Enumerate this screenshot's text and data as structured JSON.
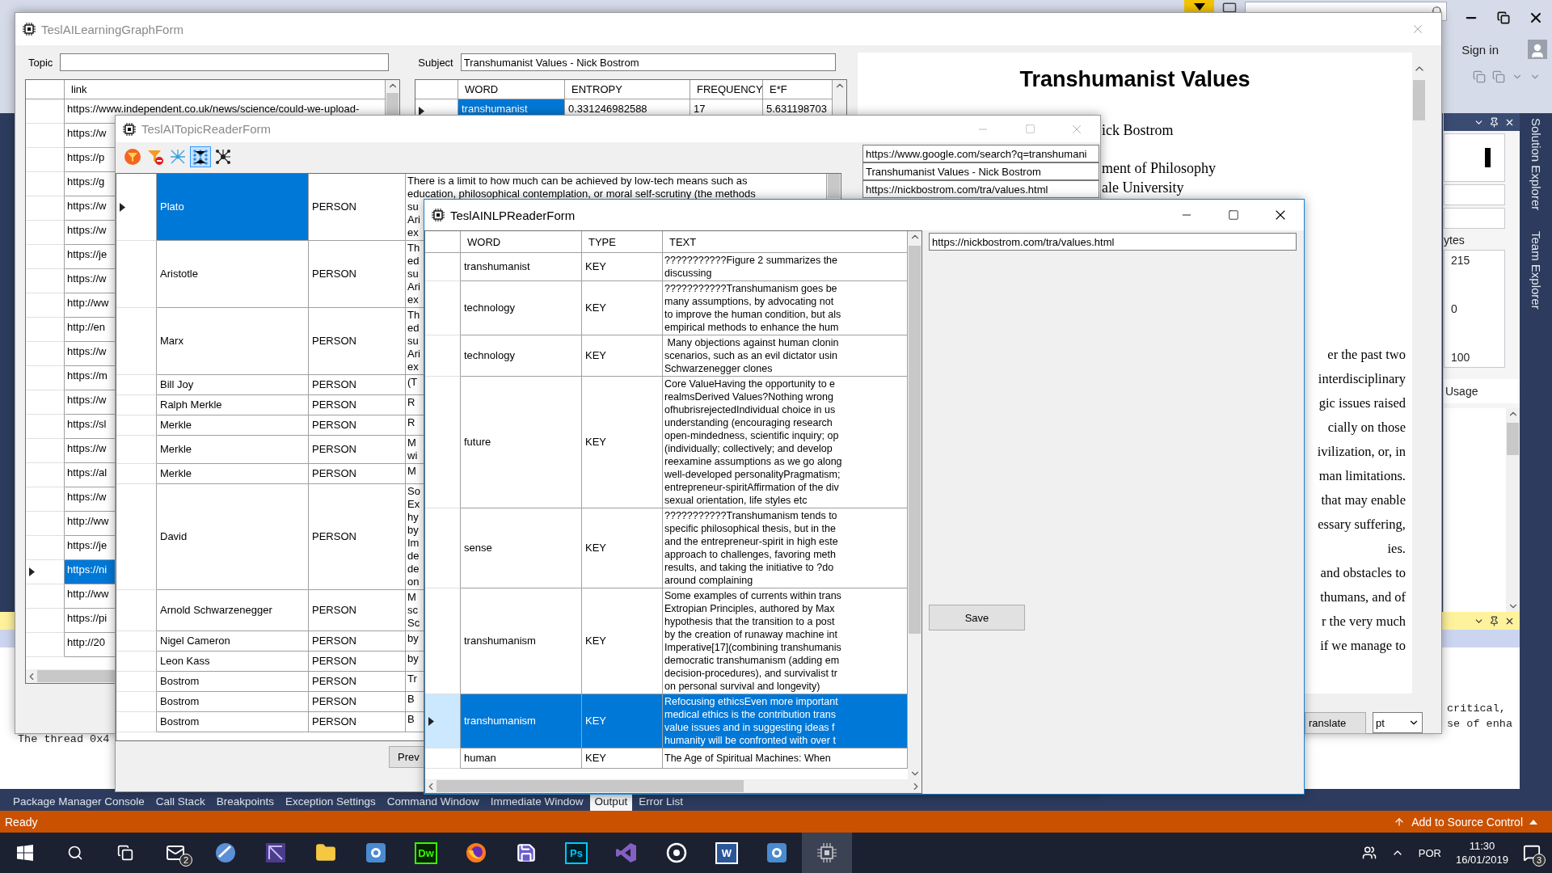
{
  "vs": {
    "sign_in": "Sign in",
    "side_tabs": [
      "Solution Explorer",
      "Team Explorer"
    ],
    "properties": {
      "label": "ytes",
      "values": [
        "215",
        "0",
        "100"
      ],
      "section": "Usage"
    },
    "output": {
      "right_lines": [
        "critical,",
        "se of enha"
      ],
      "left_line": "The thread 0x4"
    },
    "bottom_tabs": [
      {
        "label": "Package Manager Console",
        "selected": false
      },
      {
        "label": "Call Stack",
        "selected": false
      },
      {
        "label": "Breakpoints",
        "selected": false
      },
      {
        "label": "Exception Settings",
        "selected": false
      },
      {
        "label": "Command Window",
        "selected": false
      },
      {
        "label": "Immediate Window",
        "selected": false
      },
      {
        "label": "Output",
        "selected": true
      },
      {
        "label": "Error List",
        "selected": false
      }
    ],
    "status": {
      "text": "Ready",
      "source_control": "Add to Source Control"
    }
  },
  "learning_form": {
    "title": "TeslAILearningGraphForm",
    "active": false,
    "topic": {
      "label": "Topic"
    },
    "subject": {
      "label": "Subject",
      "value": "Transhumanist Values - Nick Bostrom"
    },
    "links": {
      "column": "link",
      "rows": [
        {
          "url": "https://www.independent.co.uk/news/science/could-we-upload-",
          "selected": false
        },
        {
          "url": "https://w",
          "selected": false
        },
        {
          "url": "https://p",
          "selected": false
        },
        {
          "url": "https://g",
          "selected": false
        },
        {
          "url": "https://w",
          "selected": false
        },
        {
          "url": "https://w",
          "selected": false
        },
        {
          "url": "https://je",
          "selected": false
        },
        {
          "url": "https://w",
          "selected": false
        },
        {
          "url": "http://ww",
          "selected": false
        },
        {
          "url": "http://en",
          "selected": false
        },
        {
          "url": "https://w",
          "selected": false
        },
        {
          "url": "https://m",
          "selected": false
        },
        {
          "url": "https://w",
          "selected": false
        },
        {
          "url": "https://sl",
          "selected": false
        },
        {
          "url": "https://w",
          "selected": false
        },
        {
          "url": "https://al",
          "selected": false
        },
        {
          "url": "https://w",
          "selected": false
        },
        {
          "url": "http://ww",
          "selected": false
        },
        {
          "url": "https://je",
          "selected": false
        },
        {
          "url": "https://ni",
          "selected": true
        },
        {
          "url": "http://ww",
          "selected": false
        },
        {
          "url": "https://pi",
          "selected": false
        },
        {
          "url": "http://20",
          "selected": false
        }
      ]
    },
    "words": {
      "columns": [
        "WORD",
        "ENTROPY",
        "FREQUENCY",
        "E*F"
      ],
      "rows": [
        {
          "cells": [
            "transhumanist",
            "0.331246982588",
            "17",
            "5.631198703"
          ],
          "selected": true
        }
      ]
    },
    "web": {
      "heading": "Transhumanist Values",
      "author": "ick Bostrom",
      "affiliation": [
        "ment of Philosophy",
        "ale University"
      ],
      "paragraph": [
        "er the past two",
        "interdisciplinary",
        "gic issues raised",
        "cially on those",
        "ivilization, or, in",
        "man limitations.",
        "that may enable",
        "essary suffering,",
        "ies.",
        "and obstacles to",
        "thumans, and of",
        "r the very much",
        "if we manage to"
      ]
    },
    "translate": "ranslate",
    "language": "pt"
  },
  "topic_form": {
    "title": "TeslAITopicReaderForm",
    "active": false,
    "toolbar": [
      {
        "kind": "filter",
        "selected": false
      },
      {
        "kind": "filter-remove",
        "selected": false
      },
      {
        "kind": "network",
        "selected": false
      },
      {
        "kind": "layers",
        "selected": true
      },
      {
        "kind": "nodes",
        "selected": false
      }
    ],
    "rows": [
      {
        "name": "Plato",
        "type": "PERSON",
        "text": "There is a limit to how much can be achieved by low-tech means such as\neducation, philosophical contemplation, or moral self-scrutiny (the methods\nsu\nAri\nex",
        "selected": true
      },
      {
        "name": "Aristotle",
        "type": "PERSON",
        "text": "Th\ned\nsu\nAri\nex",
        "selected": false
      },
      {
        "name": "Marx",
        "type": "PERSON",
        "text": "Th\ned\nsu\nAri\nex",
        "selected": false
      },
      {
        "name": "Bill Joy",
        "type": "PERSON",
        "text": "(T",
        "selected": false
      },
      {
        "name": "Ralph Merkle",
        "type": "PERSON",
        "text": "R",
        "selected": false
      },
      {
        "name": "Merkle",
        "type": "PERSON",
        "text": "R",
        "selected": false
      },
      {
        "name": "Merkle",
        "type": "PERSON",
        "text": "M\nwi",
        "selected": false
      },
      {
        "name": "Merkle",
        "type": "PERSON",
        "text": "M",
        "selected": false
      },
      {
        "name": "David",
        "type": "PERSON",
        "text": "So\nEx\nhy\nby\nIm\nde\nde\non",
        "selected": false
      },
      {
        "name": "Arnold Schwarzenegger",
        "type": "PERSON",
        "text": "M\nsc\nSc",
        "selected": false
      },
      {
        "name": "Nigel Cameron",
        "type": "PERSON",
        "text": "by",
        "selected": false
      },
      {
        "name": "Leon Kass",
        "type": "PERSON",
        "text": "by",
        "selected": false
      },
      {
        "name": "Bostrom",
        "type": "PERSON",
        "text": "Tr",
        "selected": false
      },
      {
        "name": "Bostrom",
        "type": "PERSON",
        "text": "B",
        "selected": false
      },
      {
        "name": "Bostrom",
        "type": "PERSON",
        "text": "B",
        "selected": false
      }
    ],
    "fields": [
      "https://www.google.com/search?q=transhumani",
      "Transhumanist Values - Nick Bostrom",
      "https://nickbostrom.com/tra/values.html"
    ],
    "prev_button": "Prev"
  },
  "nlp_form": {
    "title": "TeslAINLPReaderForm",
    "active": true,
    "columns": [
      "WORD",
      "TYPE",
      "TEXT"
    ],
    "rows": [
      {
        "word": "transhumanist",
        "type": "KEY",
        "text": "???????????Figure 2 summarizes the\ndiscussing",
        "selected": false
      },
      {
        "word": "technology",
        "type": "KEY",
        "text": "???????????Transhumanism goes be\nmany assumptions, by advocating not\nto improve the human condition, but als\nempirical methods to enhance the hum",
        "selected": false
      },
      {
        "word": "technology",
        "type": "KEY",
        "text": " Many objections against human clonin\nscenarios, such as an evil dictator usin\nSchwarzenegger clones",
        "selected": false
      },
      {
        "word": "future",
        "type": "KEY",
        "text": "Core ValueHaving the opportunity to e\nrealmsDerived Values?Nothing wrong\nofhubrisrejectedIndividual choice in us\nunderstanding (encouraging research\nopen-mindedness, scientific inquiry; op\n(individually; collectively; and develop\nreexamine assumptions as we go along\nwell-developed personalityPragmatism;\nentrepreneur-spiritAffirmation of the div\nsexual orientation, life styles etc",
        "selected": false
      },
      {
        "word": "sense",
        "type": "KEY",
        "text": "???????????Transhumanism tends to\nspecific philosophical thesis, but in the\nand the entrepreneur-spirit in high este\napproach to challenges, favoring meth\nresults, and taking the initiative to ?do\naround complaining",
        "selected": false
      },
      {
        "word": "transhumanism",
        "type": "KEY",
        "text": "Some examples of currents within trans\nExtropian Principles, authored by Max\nhypothesis that the transition to a post\nby the creation of runaway machine int\nImperative[17](combining transhumanis\ndemocratic transhumanism (adding em\ndecision-procedures), and survivalist tr\non personal survival and longevity)",
        "selected": false
      },
      {
        "word": "transhumanism",
        "type": "KEY",
        "text": "Refocusing ethicsEven more important\nmedical ethics is the contribution trans\nvalue issues and in suggesting ideas f\nhumanity will be confronted with over t",
        "selected": true
      },
      {
        "word": "human",
        "type": "KEY",
        "text": "The Age of Spiritual Machines: When",
        "selected": false
      }
    ],
    "url": "https://nickbostrom.com/tra/values.html",
    "save": "Save"
  },
  "taskbar": {
    "apps": [
      {
        "kind": "windows",
        "selected": false
      },
      {
        "kind": "search",
        "selected": false
      },
      {
        "kind": "taskview",
        "selected": false
      },
      {
        "kind": "mail",
        "badge": "2",
        "selected": false
      },
      {
        "kind": "globe",
        "selected": false
      },
      {
        "kind": "video",
        "selected": false
      },
      {
        "kind": "folder",
        "selected": false
      },
      {
        "kind": "camera",
        "selected": false
      },
      {
        "kind": "dw",
        "label": "Dw",
        "selected": false
      },
      {
        "kind": "firefox",
        "selected": false
      },
      {
        "kind": "floppy",
        "selected": false
      },
      {
        "kind": "ps",
        "label": "Ps",
        "selected": false
      },
      {
        "kind": "vs",
        "selected": false
      },
      {
        "kind": "disc",
        "selected": false
      },
      {
        "kind": "word",
        "label": "W",
        "selected": false
      },
      {
        "kind": "camera",
        "selected": false
      },
      {
        "kind": "chip",
        "selected": true
      }
    ],
    "language": "POR",
    "time": "11:30",
    "date": "16/01/2019",
    "notifications": "3"
  }
}
